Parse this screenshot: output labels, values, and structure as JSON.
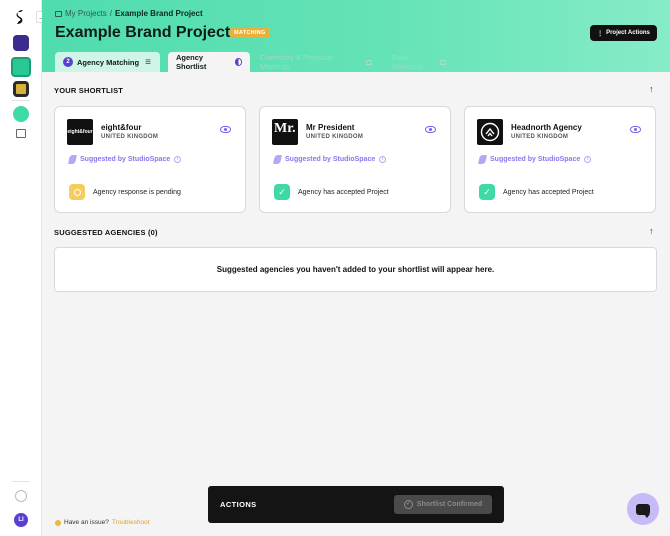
{
  "breadcrumb": {
    "parent": "My Projects",
    "separator": "/",
    "current": "Example Brand Project"
  },
  "page": {
    "title": "Example Brand Project",
    "status": "MATCHING",
    "actions_label": "Project Actions"
  },
  "tabs": [
    {
      "label": "Agency Matching",
      "count": "2"
    },
    {
      "label": "Agency Shortlist"
    },
    {
      "label": "Chemistry & Proposal Meetings"
    },
    {
      "label": "Final Selection"
    }
  ],
  "shortlist": {
    "title": "YOUR SHORTLIST",
    "suggested_label": "Suggested by StudioSpace",
    "cards": [
      {
        "name": "eight&four",
        "country": "UNITED KINGDOM",
        "logo_text": "eight&four",
        "status": "Agency response is pending",
        "status_type": "pending"
      },
      {
        "name": "Mr President",
        "country": "UNITED KINGDOM",
        "logo_text": "Mr.",
        "status": "Agency has accepted Project",
        "status_type": "accepted"
      },
      {
        "name": "Headnorth Agency",
        "country": "UNITED KINGDOM",
        "logo_text": "",
        "status": "Agency has accepted Project",
        "status_type": "accepted"
      }
    ]
  },
  "suggested": {
    "title": "SUGGESTED AGENCIES (0)",
    "empty_message": "Suggested agencies you haven't added to your shortlist will appear here."
  },
  "footer": {
    "issue_text": "Have an issue?",
    "issue_link": "Troubleshoot"
  },
  "actions": {
    "label": "ACTIONS",
    "confirm_label": "Shortlist Confirmed"
  },
  "user": {
    "initials": "LI"
  },
  "colors": {
    "accent": "#5b3fd1",
    "header": "#4fdcaf",
    "status": "#e8b13c",
    "success": "#3fd9a4",
    "pending": "#f4cc5f"
  }
}
